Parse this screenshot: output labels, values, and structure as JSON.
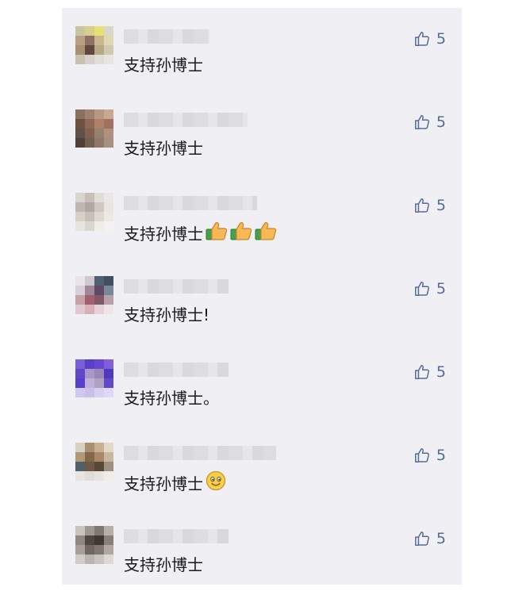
{
  "comments": [
    {
      "text": "支持孙博士",
      "likes": "5",
      "emoji": [],
      "avatar_colors": [
        "#c9c5a0",
        "#d8d08a",
        "#e8e070",
        "#d8d8c8",
        "#b8a080",
        "#907060",
        "#c8b890",
        "#e0d8b0",
        "#a89070",
        "#604840",
        "#b8a888",
        "#d0c8b0",
        "#c8c0b0",
        "#d8d0c8",
        "#e0dcd8",
        "#e8e4e0"
      ]
    },
    {
      "text": "支持孙博士",
      "likes": "5",
      "emoji": [],
      "avatar_colors": [
        "#8a7060",
        "#a08070",
        "#b89880",
        "#c8a890",
        "#705040",
        "#906858",
        "#b08068",
        "#a07060",
        "#605048",
        "#806050",
        "#988070",
        "#b09080",
        "#504038",
        "#706050",
        "#907868",
        "#a89080"
      ]
    },
    {
      "text": "支持孙博士",
      "likes": "5",
      "emoji": [
        "thumbs-up-emoji",
        "thumbs-up-emoji",
        "thumbs-up-emoji"
      ],
      "avatar_colors": [
        "#d8d4d0",
        "#c8c0b8",
        "#e0dcd8",
        "#eae8e6",
        "#c0b8b0",
        "#b0a8a0",
        "#d0c8c0",
        "#e8e4e0",
        "#d8d0c8",
        "#c8c0b8",
        "#e0d8d0",
        "#ece8e4",
        "#e8e4e0",
        "#dcd6d0",
        "#f0ece8",
        "#f4f2f0"
      ]
    },
    {
      "text": "支持孙博士!",
      "likes": "5",
      "emoji": [],
      "avatar_colors": [
        "#e8e4e8",
        "#d0c8d0",
        "#506070",
        "#405060",
        "#d8d0d8",
        "#a08898",
        "#604860",
        "#788898",
        "#c8a0a8",
        "#a06070",
        "#805868",
        "#b8a0a8",
        "#e0c8d0",
        "#d8b0b8",
        "#e8d0d8",
        "#f0e4e8"
      ]
    },
    {
      "text": "支持孙博士。",
      "likes": "5",
      "emoji": [],
      "avatar_colors": [
        "#7a60d8",
        "#5a40c8",
        "#6848d0",
        "#8060d8",
        "#6048c8",
        "#a898c8",
        "#9888b8",
        "#5038c0",
        "#5840c8",
        "#c0b0d8",
        "#b0a0c8",
        "#6048c8",
        "#d0c8f0",
        "#c8c0e8",
        "#d8d0f0",
        "#e0d8f4"
      ]
    },
    {
      "text": "支持孙博士",
      "likes": "5",
      "emoji": [
        "smile-emoji"
      ],
      "avatar_colors": [
        "#d8d0c0",
        "#a89070",
        "#c8b090",
        "#e0d8c8",
        "#b09878",
        "#806848",
        "#a88868",
        "#c8b8a0",
        "#506068",
        "#705848",
        "#584838",
        "#a09080",
        "#e8e4e0",
        "#e0dcd8",
        "#e8e4e0",
        "#f0ece8"
      ]
    },
    {
      "text": "支持孙博士",
      "likes": "5",
      "emoji": [],
      "avatar_colors": [
        "#c8c4c0",
        "#a09890",
        "#807870",
        "#b8b0a8",
        "#908880",
        "#504840",
        "#403830",
        "#888078",
        "#a8a098",
        "#706860",
        "#807870",
        "#b0a8a0",
        "#d0ccc8",
        "#b8b4b0",
        "#c8c4c0",
        "#dcd8d4"
      ]
    }
  ]
}
